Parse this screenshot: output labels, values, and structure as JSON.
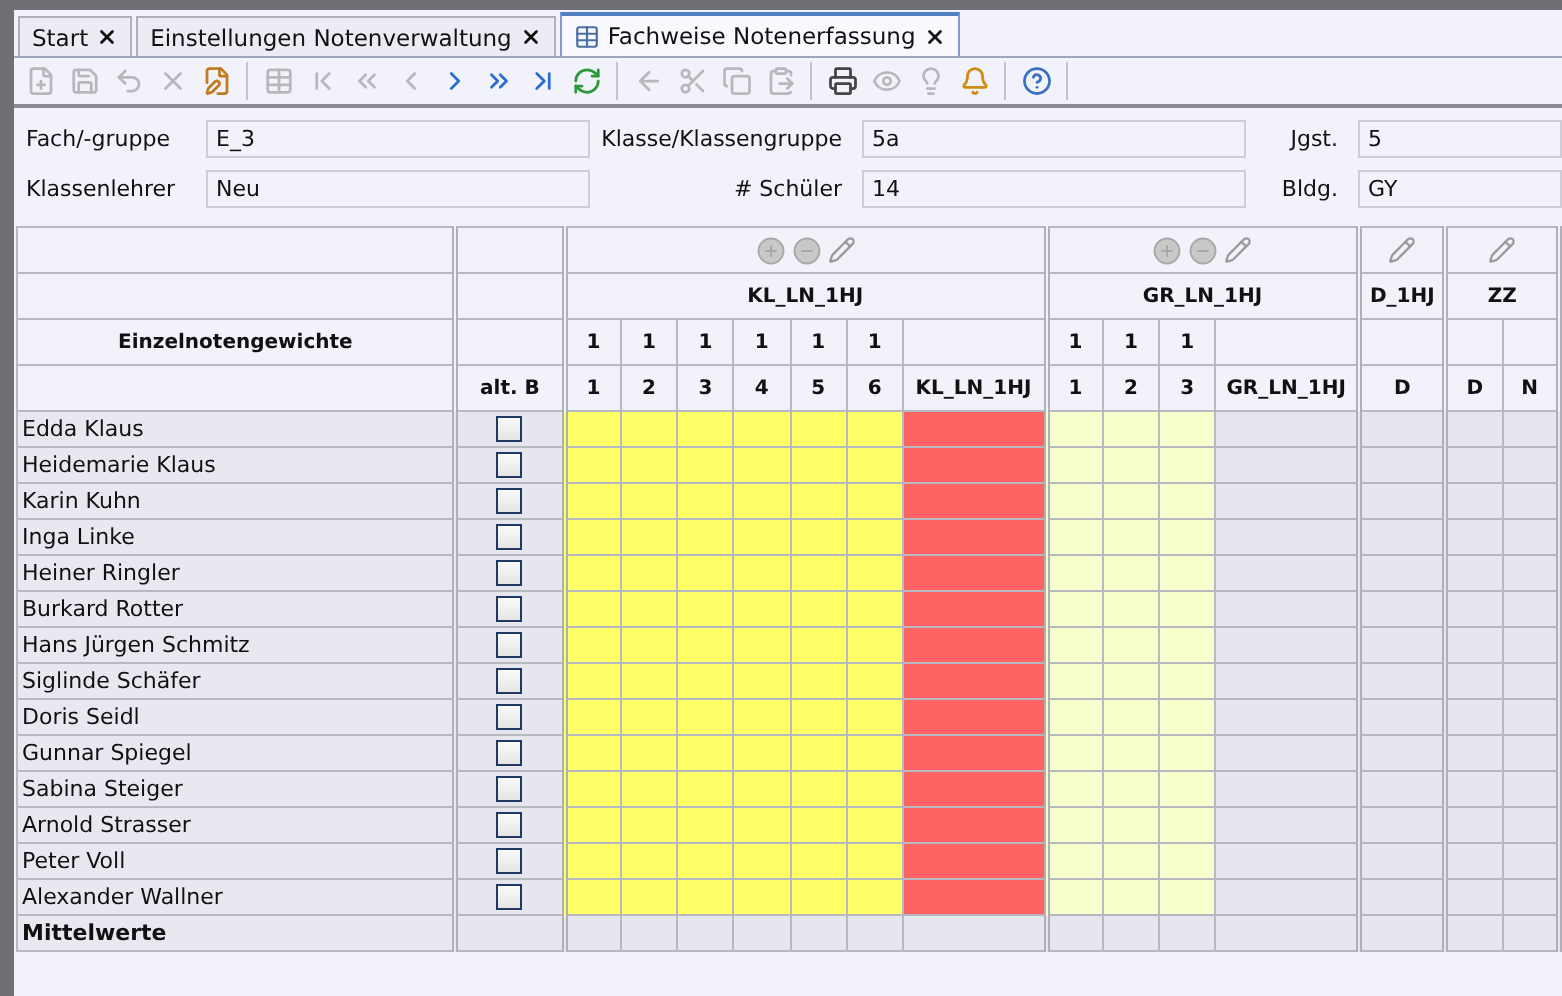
{
  "tabs": [
    {
      "label": "Start",
      "selected": false
    },
    {
      "label": "Einstellungen Notenverwaltung",
      "selected": false
    },
    {
      "label": "Fachweise Notenerfassung",
      "selected": true
    }
  ],
  "toolbar": [
    [
      {
        "disabled": true
      },
      {
        "disabled": true
      },
      {
        "disabled": true
      },
      {
        "disabled": true
      },
      {
        "disabled": false
      }
    ],
    [
      {
        "disabled": true
      },
      {
        "disabled": true
      },
      {
        "disabled": true
      },
      {
        "disabled": true
      },
      {
        "disabled": false
      },
      {
        "disabled": false
      },
      {
        "disabled": false
      },
      {
        "disabled": false
      }
    ],
    [
      {
        "disabled": true
      },
      {
        "disabled": true
      },
      {
        "disabled": true
      },
      {
        "disabled": true
      }
    ],
    [
      {
        "disabled": false
      },
      {
        "disabled": true
      },
      {
        "disabled": true
      },
      {
        "disabled": false
      }
    ],
    [
      {
        "disabled": false
      }
    ]
  ],
  "form": [
    {
      "label": "Fach/-gruppe",
      "value": "E_3"
    },
    {
      "label": "Klasse/Klassengruppe",
      "value": "5a"
    },
    {
      "label": "Jgst.",
      "value": "5"
    },
    {
      "label": "Klassenlehrer",
      "value": "Neu"
    },
    {
      "label": "# Schüler",
      "value": "14"
    },
    {
      "label": "Bldg.",
      "value": "GY"
    }
  ],
  "table": {
    "name_header": "Einzelnotengewichte",
    "alt_header": "alt. B",
    "footer": "Mittelwerte",
    "groups": [
      {
        "title": "KL_LN_1HJ",
        "tools": [
          {
            "kind": "add"
          },
          {
            "kind": "remove"
          },
          {
            "kind": "edit"
          }
        ],
        "columns": [
          {
            "weight": "1",
            "label": "1",
            "kind": "entry"
          },
          {
            "weight": "1",
            "label": "2",
            "kind": "entry"
          },
          {
            "weight": "1",
            "label": "3",
            "kind": "entry"
          },
          {
            "weight": "1",
            "label": "4",
            "kind": "entry"
          },
          {
            "weight": "1",
            "label": "5",
            "kind": "entry"
          },
          {
            "weight": "1",
            "label": "6",
            "kind": "entry"
          },
          {
            "label": "KL_LN_1HJ",
            "kind": "missing"
          }
        ]
      },
      {
        "title": "GR_LN_1HJ",
        "tools": [
          {
            "kind": "add"
          },
          {
            "kind": "remove"
          },
          {
            "kind": "edit"
          }
        ],
        "columns": [
          {
            "weight": "1",
            "label": "1",
            "kind": "light"
          },
          {
            "weight": "1",
            "label": "2",
            "kind": "light"
          },
          {
            "weight": "1",
            "label": "3",
            "kind": "light"
          },
          {
            "label": "GR_LN_1HJ",
            "kind": "plain"
          }
        ]
      },
      {
        "title": "D_1HJ",
        "tools": [
          {
            "kind": "edit"
          }
        ],
        "columns": [
          {
            "label": "D",
            "kind": "plain"
          }
        ]
      },
      {
        "title": "ZZ",
        "tools": [
          {
            "kind": "edit"
          }
        ],
        "columns": [
          {
            "label": "D",
            "kind": "plain"
          },
          {
            "label": "N",
            "kind": "plain"
          }
        ]
      }
    ],
    "rows": [
      {
        "name": "Edda Klaus",
        "alt_b": false
      },
      {
        "name": "Heidemarie Klaus",
        "alt_b": false
      },
      {
        "name": "Karin Kuhn",
        "alt_b": false
      },
      {
        "name": "Inga Linke",
        "alt_b": false
      },
      {
        "name": "Heiner Ringler",
        "alt_b": false
      },
      {
        "name": "Burkard Rotter",
        "alt_b": false
      },
      {
        "name": "Hans Jürgen Schmitz",
        "alt_b": false
      },
      {
        "name": "Siglinde Schäfer",
        "alt_b": false
      },
      {
        "name": "Doris Seidl",
        "alt_b": false
      },
      {
        "name": "Gunnar Spiegel",
        "alt_b": false
      },
      {
        "name": "Sabina Steiger",
        "alt_b": false
      },
      {
        "name": "Arnold Strasser",
        "alt_b": false
      },
      {
        "name": "Peter Voll",
        "alt_b": false
      },
      {
        "name": "Alexander Wallner",
        "alt_b": false
      }
    ]
  }
}
